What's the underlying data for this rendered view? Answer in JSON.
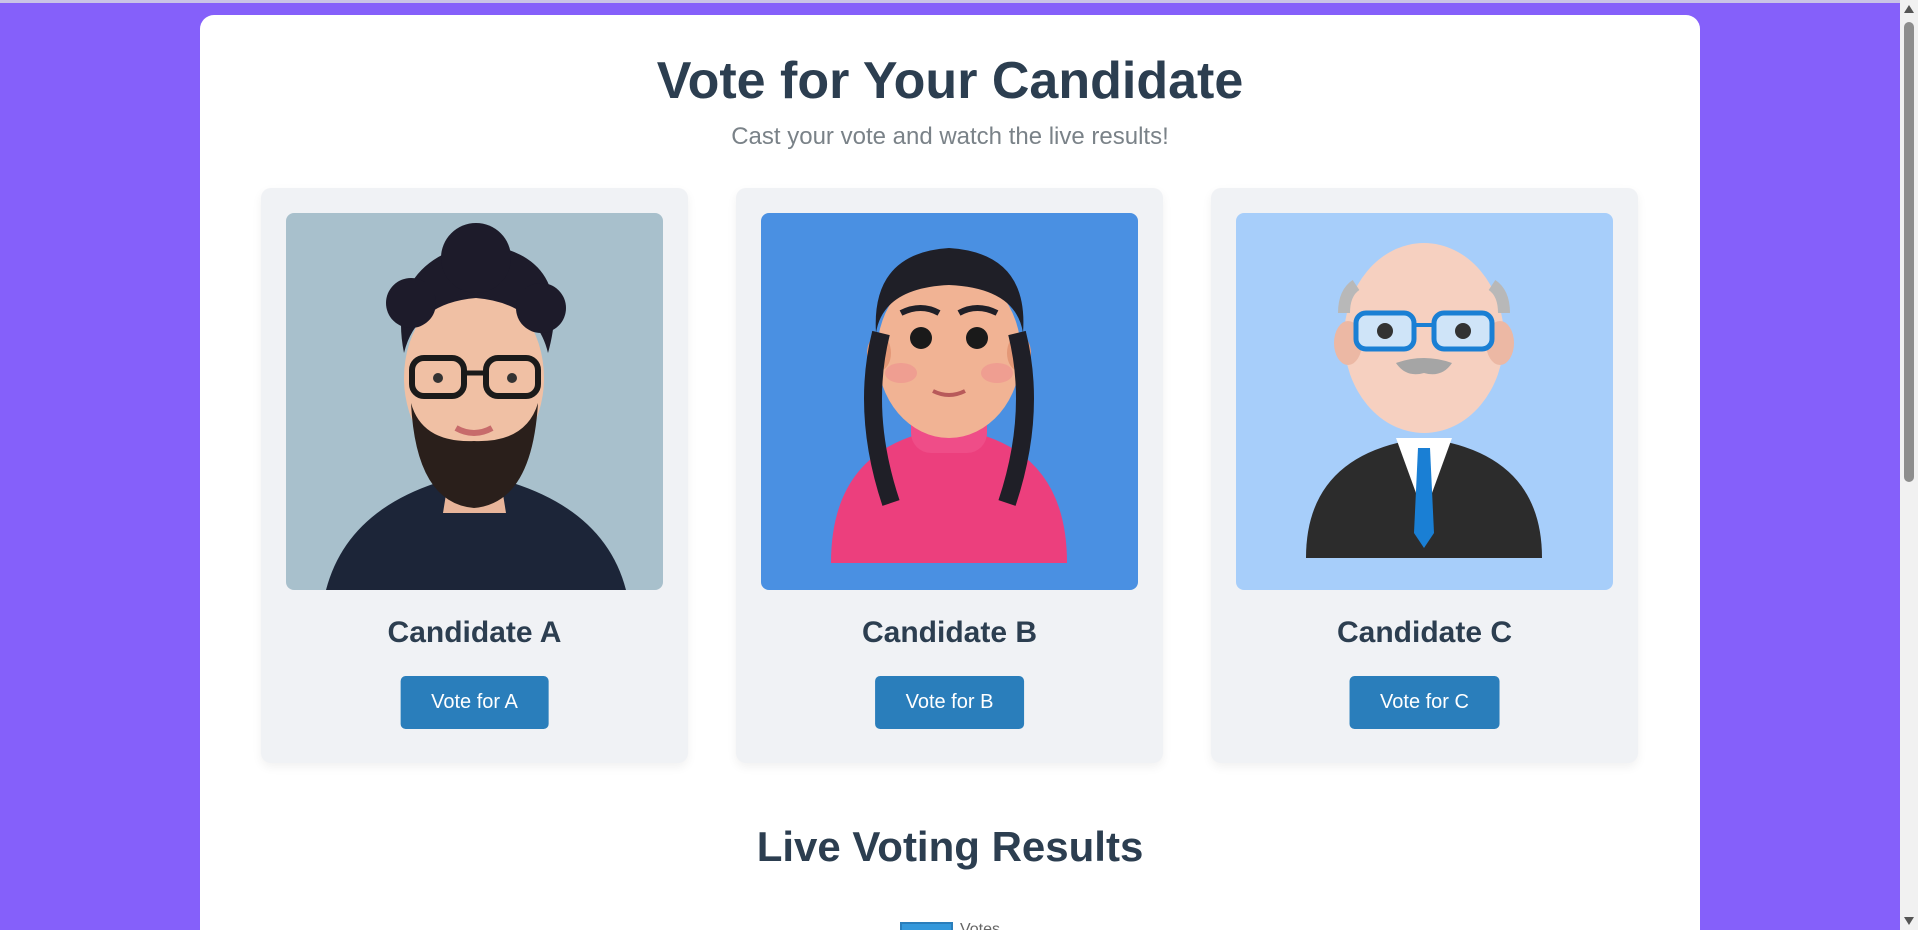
{
  "header": {
    "title": "Vote for Your Candidate",
    "subtitle": "Cast your vote and watch the live results!"
  },
  "candidates": [
    {
      "name": "Candidate A",
      "button": "Vote for A",
      "photo_bg": "#a8c0cc",
      "icon": "man-with-beard-avatar"
    },
    {
      "name": "Candidate B",
      "button": "Vote for B",
      "photo_bg": "#4a90e2",
      "icon": "girl-with-braids-avatar"
    },
    {
      "name": "Candidate C",
      "button": "Vote for C",
      "photo_bg": "#a7cefa",
      "icon": "bald-man-in-suit-avatar"
    }
  ],
  "results": {
    "title": "Live Voting Results",
    "legend_label": "Votes",
    "legend_color": "#3498db"
  },
  "colors": {
    "page_bg": "#8560fa",
    "accent_button": "#2a7ebb",
    "heading": "#2c3e50"
  }
}
